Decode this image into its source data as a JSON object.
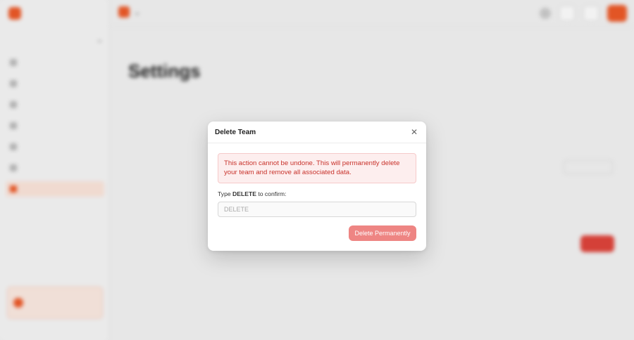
{
  "app": {
    "logo_text": "",
    "team_switch": "",
    "nav": [
      {
        "label": ""
      },
      {
        "label": ""
      },
      {
        "label": ""
      },
      {
        "label": ""
      },
      {
        "label": ""
      },
      {
        "label": ""
      },
      {
        "label": "",
        "active": true
      }
    ],
    "page_title": "Settings",
    "accent_color": "#ef5a28"
  },
  "modal": {
    "title": "Delete Team",
    "close_icon": "close-icon",
    "warning": "This action cannot be undone. This will permanently delete your team and remove all associated data.",
    "confirm_prefix": "Type",
    "confirm_keyword": "DELETE",
    "confirm_suffix": "to confirm:",
    "input_value": "",
    "input_placeholder": "DELETE",
    "delete_label": "Delete Permanently",
    "warning_color": "#c8322b",
    "delete_button_color": "#ee8583"
  }
}
